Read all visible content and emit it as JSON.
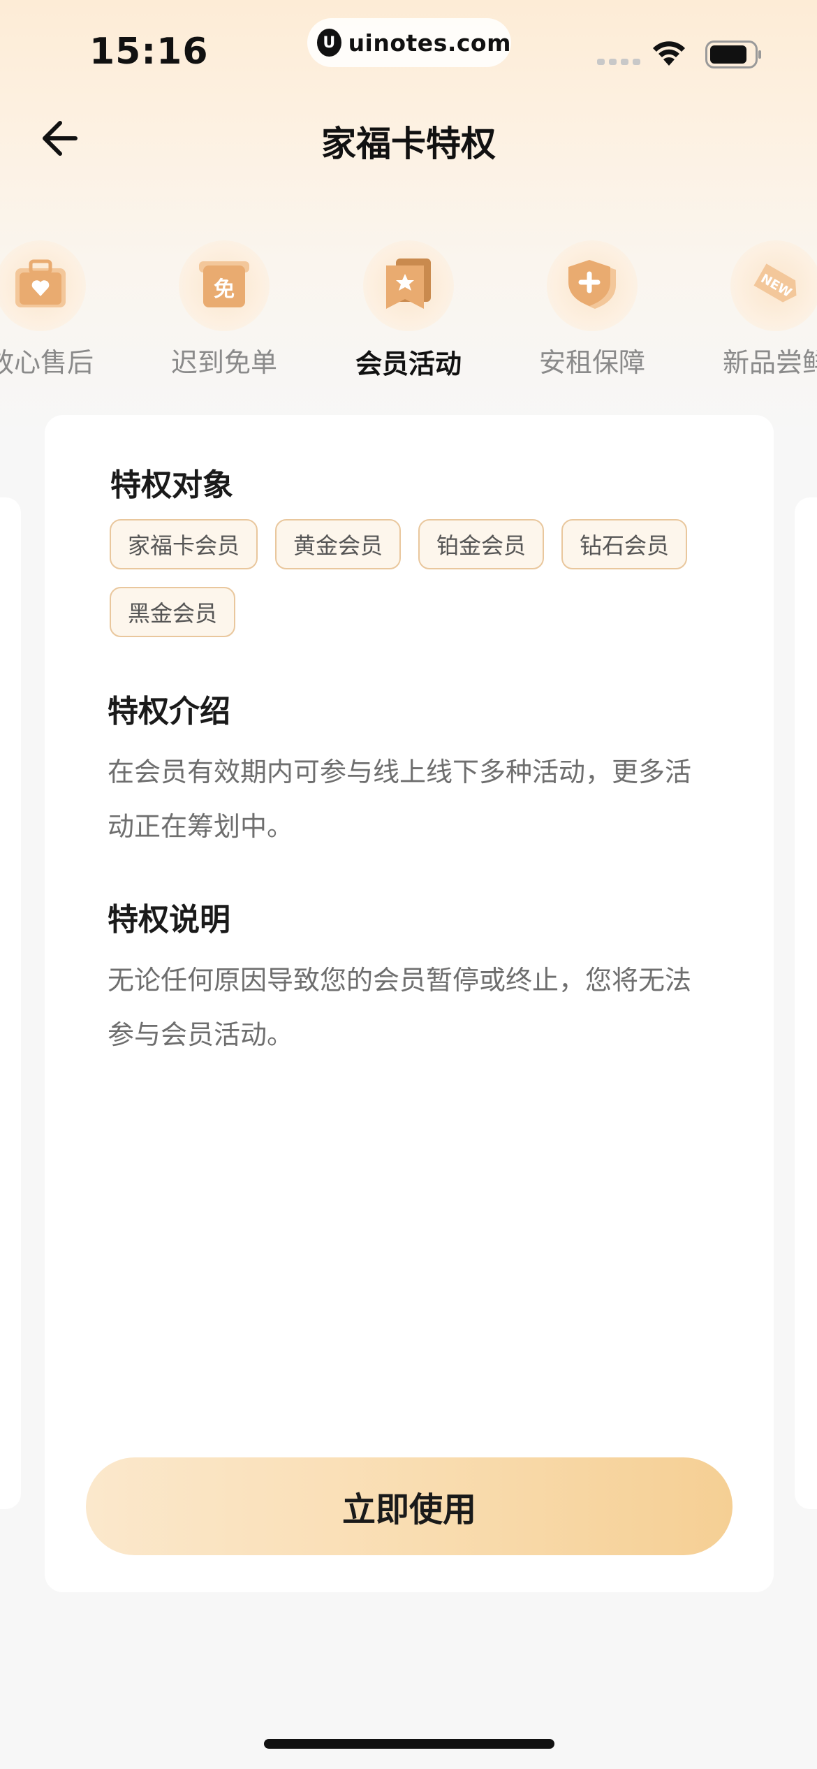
{
  "status_bar": {
    "time": "15:16",
    "url_logo_letter": "U",
    "url": "uinotes.com"
  },
  "nav": {
    "back_icon": "arrow-left-icon",
    "title": "家福卡特权"
  },
  "tabs": [
    {
      "label": "放心售后",
      "icon": "heart-bag-icon",
      "active": false
    },
    {
      "label": "迟到免单",
      "icon": "free-order-icon",
      "active": false,
      "icon_text": "免"
    },
    {
      "label": "会员活动",
      "icon": "star-flag-icon",
      "active": true
    },
    {
      "label": "安租保障",
      "icon": "shield-plus-icon",
      "active": false
    },
    {
      "label": "新品尝鲜",
      "icon": "new-tag-icon",
      "active": false,
      "icon_text": "NEW"
    }
  ],
  "card": {
    "target": {
      "title": "特权对象",
      "chips": [
        "家福卡会员",
        "黄金会员",
        "铂金会员",
        "钻石会员",
        "黑金会员"
      ]
    },
    "intro": {
      "title": "特权介绍",
      "line1": "在会员有效期内可参与线上线下多种活动，更多活",
      "line2": "动正在筹划中。"
    },
    "explain": {
      "title": "特权说明",
      "line1": "无论任何原因导致您的会员暂停或终止，您将无法",
      "line2": "参与会员活动。"
    },
    "cta_label": "立即使用"
  },
  "colors": {
    "accent": "#f5cf94",
    "chip_border": "#e9c79d",
    "chip_bg": "#fdf6ec",
    "icon": "#e8a86a"
  }
}
